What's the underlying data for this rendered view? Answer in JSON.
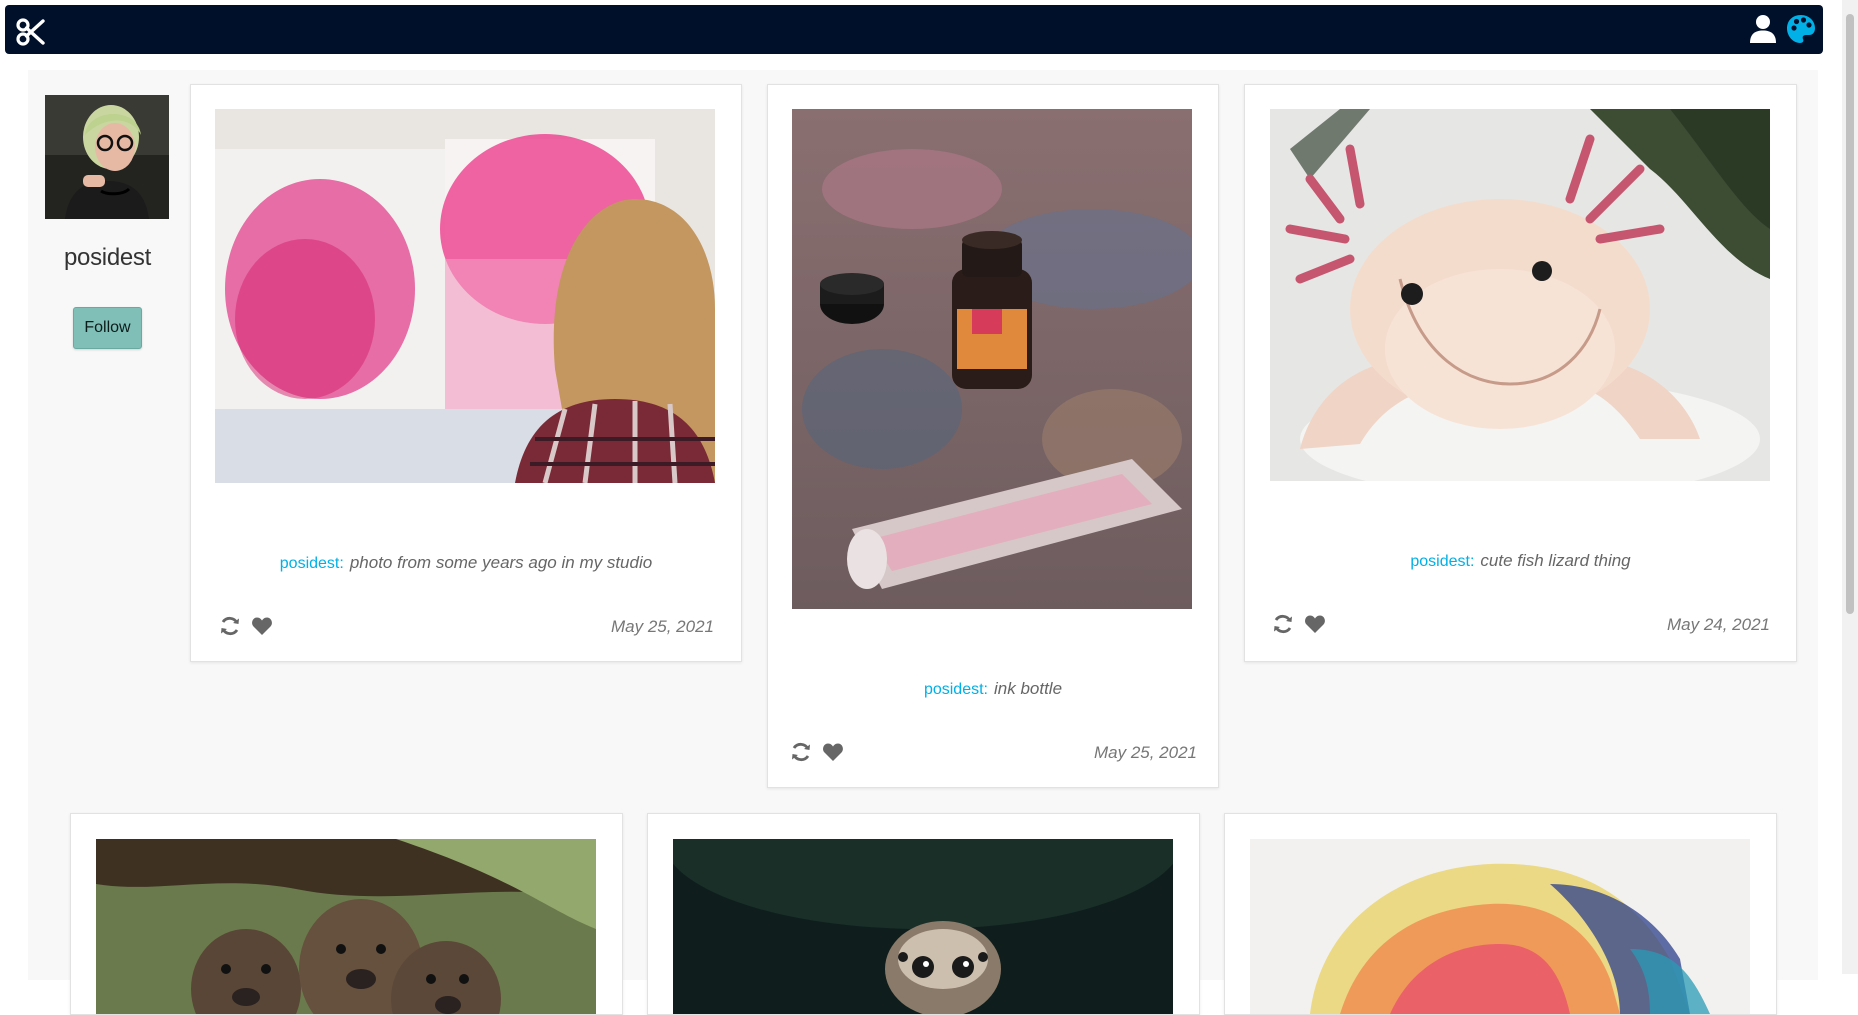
{
  "profile": {
    "username": "posidest",
    "follow_label": "Follow"
  },
  "nav": {
    "logo_icon": "scissors-icon",
    "user_icon": "user-icon",
    "theme_icon": "palette-icon"
  },
  "colors": {
    "navbar": "#00102a",
    "author_link": "#00b0e6",
    "follow_button": "#7fbfb7",
    "palette_icon": "#00b0e6"
  },
  "posts": [
    {
      "author": "posidest:",
      "caption": "photo from some years ago in my studio",
      "date": "May 25, 2021",
      "image_subject": "woman in plaid shirt facing pink splatter paintings"
    },
    {
      "author": "posidest:",
      "caption": "ink bottle",
      "date": "May 25, 2021",
      "image_subject": "ink bottle on paint-covered table"
    },
    {
      "author": "posidest:",
      "caption": "cute fish lizard thing",
      "date": "May 24, 2021",
      "image_subject": "pale pink axolotl"
    },
    {
      "image_subject": "three baby beavers"
    },
    {
      "image_subject": "jumping spider on dark background"
    },
    {
      "image_subject": "colorful watercolor dot painting"
    }
  ]
}
